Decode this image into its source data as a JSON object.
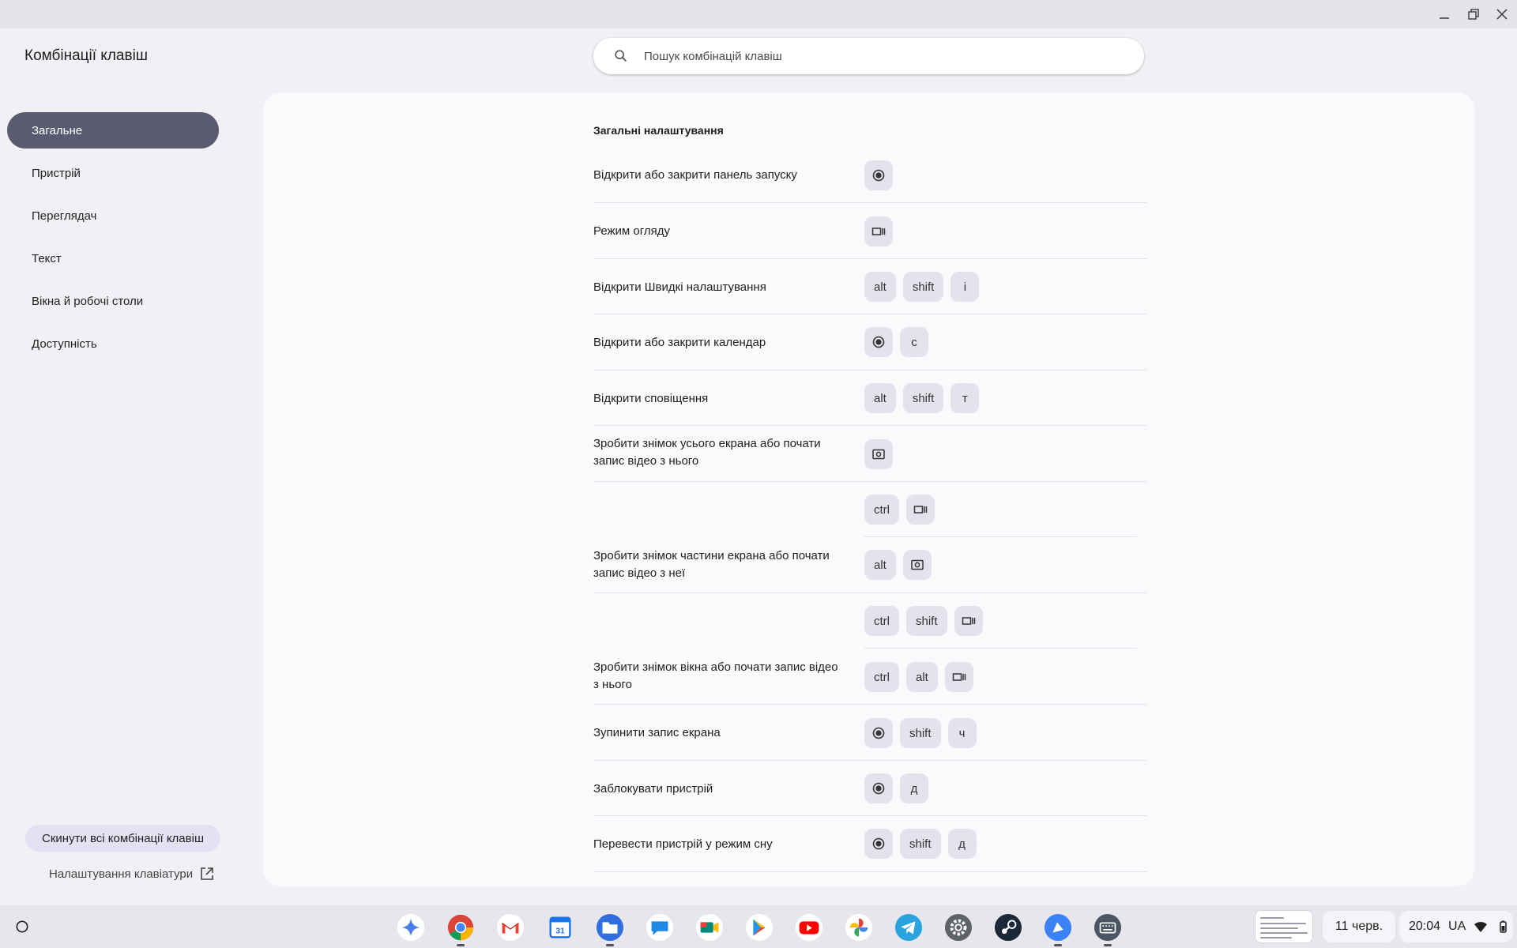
{
  "window": {
    "title": "Комбінації клавіш",
    "minimize_icon": "minimize-icon",
    "maximize_icon": "restore-icon",
    "close_icon": "close-icon"
  },
  "search": {
    "placeholder": "Пошук комбінацій клавіш",
    "icon": "search-icon"
  },
  "sidebar": {
    "items": [
      {
        "label": "Загальне",
        "active": true
      },
      {
        "label": "Пристрій",
        "active": false
      },
      {
        "label": "Переглядач",
        "active": false
      },
      {
        "label": "Текст",
        "active": false
      },
      {
        "label": "Вікна й робочі столи",
        "active": false
      },
      {
        "label": "Доступність",
        "active": false
      }
    ],
    "reset_label": "Скинути всі комбінації клавіш",
    "keyboard_settings_label": "Налаштування клавіатури"
  },
  "main": {
    "section_title": "Загальні налаштування",
    "shortcuts": [
      {
        "label": "Відкрити або закрити панель запуску",
        "combos": [
          [
            "launcher-icon"
          ]
        ]
      },
      {
        "label": "Режим огляду",
        "combos": [
          [
            "overview-icon"
          ]
        ]
      },
      {
        "label": "Відкрити Швидкі налаштування",
        "combos": [
          [
            "alt",
            "shift",
            "i"
          ]
        ]
      },
      {
        "label": "Відкрити або закрити календар",
        "combos": [
          [
            "launcher-icon",
            "c"
          ]
        ]
      },
      {
        "label": "Відкрити сповіщення",
        "combos": [
          [
            "alt",
            "shift",
            "т"
          ]
        ]
      },
      {
        "label": "Зробити знімок усього екрана або почати запис відео з нього",
        "combos": [
          [
            "screenshot-icon"
          ],
          [
            "ctrl",
            "overview-icon"
          ]
        ]
      },
      {
        "label": "Зробити знімок частини екрана або почати запис відео з неї",
        "combos": [
          [
            "alt",
            "screenshot-icon"
          ],
          [
            "ctrl",
            "shift",
            "overview-icon"
          ]
        ]
      },
      {
        "label": "Зробити знімок вікна або почати запис відео з нього",
        "combos": [
          [
            "ctrl",
            "alt",
            "overview-icon"
          ]
        ]
      },
      {
        "label": "Зупинити запис екрана",
        "combos": [
          [
            "launcher-icon",
            "shift",
            "ч"
          ]
        ]
      },
      {
        "label": "Заблокувати пристрій",
        "combos": [
          [
            "launcher-icon",
            "д"
          ]
        ]
      },
      {
        "label": "Перевести пристрій у режим сну",
        "combos": [
          [
            "launcher-icon",
            "shift",
            "д"
          ]
        ]
      }
    ]
  },
  "shelf": {
    "apps": [
      "gemini-icon",
      "chrome-icon",
      "gmail-icon",
      "calendar-icon",
      "files-icon",
      "chat-icon",
      "meet-icon",
      "play-store-icon",
      "youtube-icon",
      "photos-icon",
      "telegram-icon",
      "settings-icon",
      "steam-icon",
      "web-app-icon",
      "shortcuts-app-icon"
    ],
    "calendar_day": "31",
    "date": "11 черв.",
    "time": "20:04",
    "input_method": "UA",
    "colors": {
      "active_nav": "#5a5b71",
      "shelf": "#e7e6ec"
    }
  }
}
